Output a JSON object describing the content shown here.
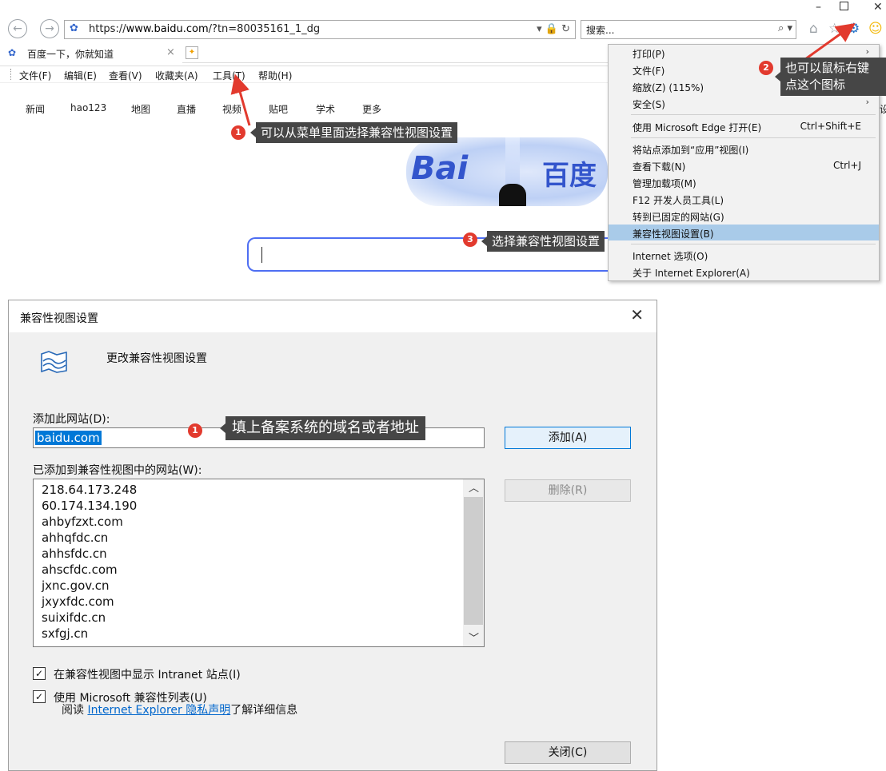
{
  "window": {
    "minimize": "–",
    "maximize": "",
    "close": "✕"
  },
  "address_bar": {
    "url_prefix": "https://",
    "url_domain": "www.baidu.com",
    "url_path": "/?tn=80035161_1_dg",
    "tools": "▾ 🔒 ↻",
    "search_placeholder": "搜索...",
    "search_button": "⌕ ▾"
  },
  "tab": {
    "title": "百度一下，你就知道",
    "close": "×"
  },
  "menu_bar": [
    "文件(F)",
    "编辑(E)",
    "查看(V)",
    "收藏夹(A)",
    "工具(T)",
    "帮助(H)"
  ],
  "nav_links": [
    "新闻",
    "hao123",
    "地图",
    "直播",
    "视频",
    "贴吧",
    "学术",
    "更多"
  ],
  "logo": {
    "left": "Bai",
    "right": "百度"
  },
  "right_edge_text": "设",
  "tools_menu": {
    "items": [
      {
        "label": "打印(P)",
        "shortcut": "",
        "arrow": "›"
      },
      {
        "label": "文件(F)",
        "shortcut": "",
        "arrow": "›"
      },
      {
        "label": "缩放(Z) (115%)",
        "shortcut": "",
        "arrow": "›"
      },
      {
        "label": "安全(S)",
        "shortcut": "",
        "arrow": "›"
      },
      {
        "label": "使用 Microsoft Edge 打开(E)",
        "shortcut": "Ctrl+Shift+E",
        "arrow": ""
      },
      {
        "label": "将站点添加到“应用”视图(I)",
        "shortcut": "",
        "arrow": ""
      },
      {
        "label": "查看下载(N)",
        "shortcut": "Ctrl+J",
        "arrow": ""
      },
      {
        "label": "管理加载项(M)",
        "shortcut": "",
        "arrow": ""
      },
      {
        "label": "F12 开发人员工具(L)",
        "shortcut": "",
        "arrow": ""
      },
      {
        "label": "转到已固定的网站(G)",
        "shortcut": "",
        "arrow": ""
      },
      {
        "label": "兼容性视图设置(B)",
        "shortcut": "",
        "arrow": "",
        "highlighted": true
      },
      {
        "label": "Internet 选项(O)",
        "shortcut": "",
        "arrow": ""
      },
      {
        "label": "关于 Internet Explorer(A)",
        "shortcut": "",
        "arrow": ""
      }
    ]
  },
  "annotations": {
    "step1_badge": "1",
    "step1_text": "可以从菜单里面选择兼容性视图设置",
    "step2_badge": "2",
    "step2_line1": "也可以鼠标右键",
    "step2_line2": "点这个图标",
    "step3_badge": "3",
    "step3_text": "选择兼容性视图设置",
    "dialog_step1_badge": "1",
    "dialog_step1_text": "填上备案系统的域名或者地址"
  },
  "dialog": {
    "title": "兼容性视图设置",
    "close": "✕",
    "heading": "更改兼容性视图设置",
    "add_label": "添加此网站(D):",
    "add_value": "baidu.com",
    "add_button": "添加(A)",
    "list_label": "已添加到兼容性视图中的网站(W):",
    "sites": [
      "218.64.173.248",
      "60.174.134.190",
      "ahbyfzxt.com",
      "ahhqfdc.cn",
      "ahhsfdc.cn",
      "ahscfdc.com",
      "jxnc.gov.cn",
      "jxyxfdc.com",
      "suixifdc.cn",
      "sxfgj.cn"
    ],
    "remove_button": "删除(R)",
    "check_intranet": "在兼容性视图中显示 Intranet 站点(I)",
    "check_intranet_checked": true,
    "check_ms_list": "使用 Microsoft 兼容性列表(U)",
    "check_ms_list_checked": true,
    "privacy_prefix": "阅读 ",
    "privacy_link": "Internet Explorer 隐私声明",
    "privacy_suffix": "了解详细信息",
    "close_button": "关闭(C)"
  },
  "colors": {
    "accent": "#0078d7",
    "badge": "#e23a2e",
    "callout_bg": "#464646",
    "menu_highlight": "#a9cbe9",
    "search_border": "#4e6ef2"
  }
}
